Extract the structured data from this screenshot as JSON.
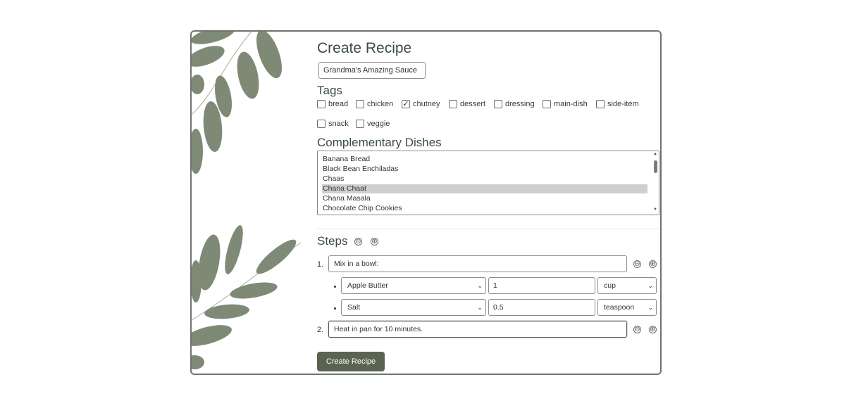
{
  "form": {
    "title": "Create Recipe",
    "recipe_name_value": "Grandma's Amazing Sauce"
  },
  "tags": {
    "heading": "Tags",
    "items": [
      {
        "label": "bread",
        "checked": false
      },
      {
        "label": "chicken",
        "checked": false
      },
      {
        "label": "chutney",
        "checked": true
      },
      {
        "label": "dessert",
        "checked": false
      },
      {
        "label": "dressing",
        "checked": false
      },
      {
        "label": "main-dish",
        "checked": false
      },
      {
        "label": "side-item",
        "checked": false
      },
      {
        "label": "snack",
        "checked": false
      },
      {
        "label": "veggie",
        "checked": false
      }
    ]
  },
  "complementary": {
    "heading": "Complementary Dishes",
    "options": [
      {
        "label": "Banana Bread",
        "selected": false
      },
      {
        "label": "Black Bean Enchiladas",
        "selected": false
      },
      {
        "label": "Chaas",
        "selected": false
      },
      {
        "label": "Chana Chaat",
        "selected": true
      },
      {
        "label": "Chana Masala",
        "selected": false
      },
      {
        "label": "Chocolate Chip Cookies",
        "selected": false
      }
    ]
  },
  "steps": {
    "heading": "Steps",
    "items": [
      {
        "number": "1.",
        "text": "Mix in a bowl:",
        "ingredients": [
          {
            "ingredient": "Apple Butter",
            "quantity": "1",
            "unit": "cup"
          },
          {
            "ingredient": "Salt",
            "quantity": "0.5",
            "unit": "teaspoon"
          }
        ]
      },
      {
        "number": "2.",
        "text": "Heat in pan for 10 minutes.",
        "ingredients": []
      }
    ]
  },
  "icons": {
    "minus": "⊖",
    "plus": "⊕",
    "check": "✓",
    "chevron": "⌄"
  },
  "submit_label": "Create Recipe",
  "colors": {
    "accent": "#5a6350",
    "border": "#6f7668",
    "leaf": "#7d8a75"
  }
}
